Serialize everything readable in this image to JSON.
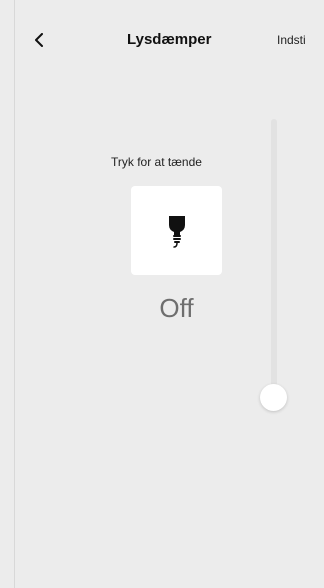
{
  "header": {
    "back_icon": "chevron-left-icon",
    "title": "Lysdæmper",
    "settings_label": "Indsti"
  },
  "light": {
    "hint": "Tryk for at tænde",
    "icon": "lightbulb-icon",
    "state": "Off",
    "level_fraction": 0
  },
  "colors": {
    "background": "#ececec",
    "card": "#ffffff",
    "state_text": "#6e6e6e"
  }
}
